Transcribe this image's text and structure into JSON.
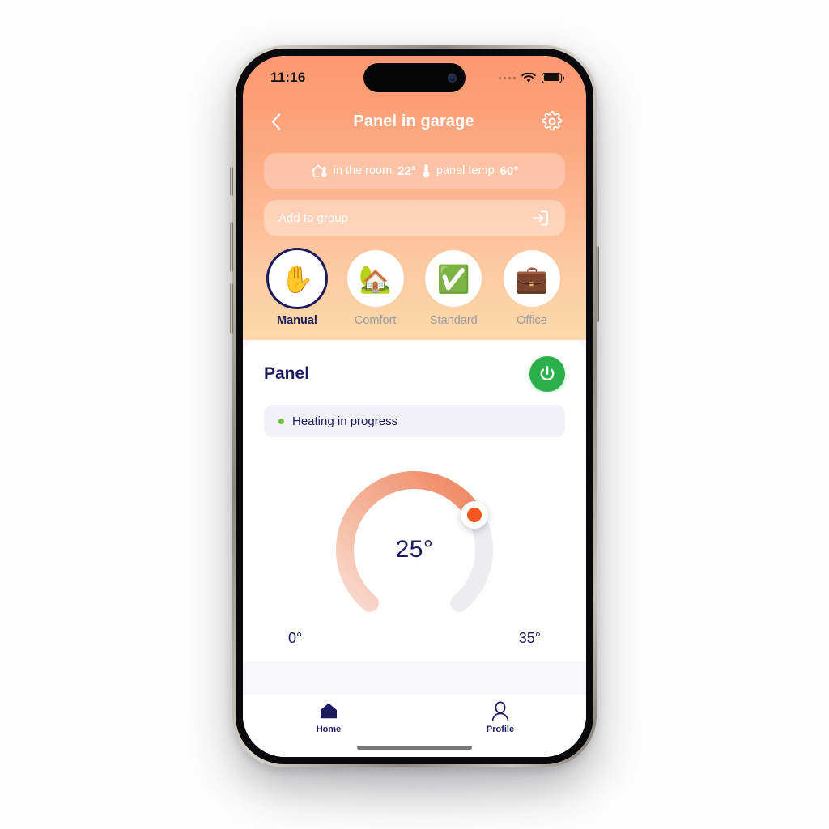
{
  "status_bar": {
    "time": "11:16",
    "signal_icon": "signal-dots-icon",
    "wifi_icon": "wifi-icon",
    "battery_icon": "battery-icon"
  },
  "header": {
    "back_icon": "chevron-left-icon",
    "title": "Panel in garage",
    "settings_icon": "gear-icon"
  },
  "info_bar": {
    "room_icon": "house-thermometer-icon",
    "room_label": "in the room",
    "room_value": "22°",
    "panel_icon": "thermometer-icon",
    "panel_label": "panel temp",
    "panel_value": "60°"
  },
  "add_to_group": {
    "label": "Add to group",
    "icon": "arrow-into-box-icon"
  },
  "modes": [
    {
      "label": "Manual",
      "emoji": "✋",
      "icon": "raised-hand-icon",
      "selected": true
    },
    {
      "label": "Comfort",
      "emoji": "🏡",
      "icon": "house-garden-icon",
      "selected": false
    },
    {
      "label": "Standard",
      "emoji": "✅",
      "icon": "check-mark-icon",
      "selected": false
    },
    {
      "label": "Office",
      "emoji": "💼",
      "icon": "briefcase-icon",
      "selected": false
    }
  ],
  "panel": {
    "title": "Panel",
    "power_icon": "power-icon",
    "status_text": "Heating in progress",
    "status_dot_color": "#6fbf3c"
  },
  "chart_data": {
    "type": "gauge",
    "title": "Panel target temperature",
    "value": 25,
    "value_label": "25°",
    "min": 0,
    "min_label": "0°",
    "max": 35,
    "max_label": "35°",
    "unit": "°",
    "sweep_degrees": 280,
    "progress_fraction": 0.714,
    "track_color": "#ececf1",
    "fill_gradient": [
      "#f9d9cd",
      "#f08a63"
    ],
    "knob_color": "#f4571f",
    "label_color": "#1b1a5e"
  },
  "bottom_nav": [
    {
      "label": "Home",
      "icon": "home-icon",
      "active": true
    },
    {
      "label": "Profile",
      "icon": "person-icon",
      "active": false
    }
  ],
  "colors": {
    "hero_top": "#fb9772",
    "hero_bottom": "#fcd9a9",
    "accent_orange": "#f4571f",
    "navy": "#1b1a5e",
    "green": "#2bb04a",
    "page_bg": "#f7f7fc"
  }
}
